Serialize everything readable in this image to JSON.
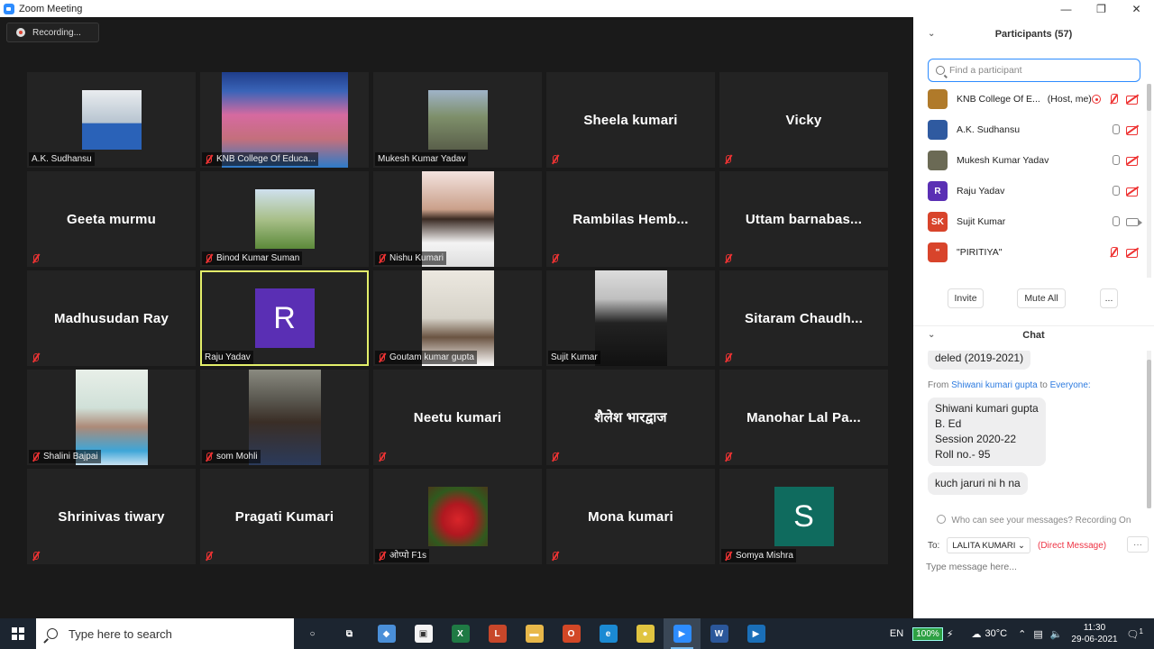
{
  "window": {
    "title": "Zoom Meeting",
    "controls": [
      "—",
      "❐",
      "✕"
    ]
  },
  "recording": {
    "label": "Recording..."
  },
  "tiles": [
    {
      "name": "A.K. Sudhansu",
      "type": "video",
      "muted": false
    },
    {
      "name": "KNB College Of Educa...",
      "type": "video",
      "muted": true
    },
    {
      "name": "Mukesh Kumar Yadav",
      "type": "video",
      "muted": false
    },
    {
      "name": "Sheela kumari",
      "type": "name",
      "muted": true
    },
    {
      "name": "Vicky",
      "type": "name",
      "muted": true
    },
    {
      "name": "Geeta murmu",
      "type": "name",
      "muted": true
    },
    {
      "name": "Binod Kumar Suman",
      "type": "video",
      "muted": true
    },
    {
      "name": "Nishu Kumari",
      "type": "video",
      "muted": true
    },
    {
      "name": "Rambilas  Hemb...",
      "type": "name",
      "muted": true
    },
    {
      "name": "Uttam  barnabas...",
      "type": "name",
      "muted": true
    },
    {
      "name": "Madhusudan Ray",
      "type": "name",
      "muted": true
    },
    {
      "name": "Raju Yadav",
      "type": "avatar",
      "letter": "R",
      "color": "#5a2fb4",
      "muted": false,
      "active": true
    },
    {
      "name": "Goutam kumar gupta",
      "type": "video",
      "muted": true
    },
    {
      "name": "Sujit Kumar",
      "type": "video",
      "muted": false
    },
    {
      "name": "Sitaram  Chaudh...",
      "type": "name",
      "muted": true
    },
    {
      "name": "Shalini Bajpai",
      "type": "video",
      "muted": true
    },
    {
      "name": "som Mohli",
      "type": "video",
      "muted": true
    },
    {
      "name": "Neetu kumari",
      "type": "name",
      "muted": true
    },
    {
      "name": "शैलेश भारद्वाज",
      "type": "name",
      "muted": true
    },
    {
      "name": "Manohar Lal Pa...",
      "type": "name",
      "muted": true
    },
    {
      "name": "Shrinivas tiwary",
      "type": "name",
      "muted": true
    },
    {
      "name": "Pragati Kumari",
      "type": "name",
      "muted": true
    },
    {
      "name": "ओप्पो F1s",
      "type": "video",
      "muted": true
    },
    {
      "name": "Mona kumari",
      "type": "name",
      "muted": true
    },
    {
      "name": "Somya Mishra",
      "type": "avatar",
      "letter": "S",
      "color": "#0f6b5e",
      "muted": true
    }
  ],
  "participants": {
    "header": "Participants (57)",
    "search_placeholder": "Find a participant",
    "list": [
      {
        "name": "KNB College Of E...",
        "suffix": "(Host, me)",
        "avatar": "",
        "color": "#b07a2a",
        "mic": "muted",
        "cam": "off",
        "rec": true
      },
      {
        "name": "A.K. Sudhansu",
        "suffix": "",
        "avatar": "",
        "color": "#2f5aa0",
        "mic": "on",
        "cam": "off",
        "rec": false
      },
      {
        "name": "Mukesh Kumar Yadav",
        "suffix": "",
        "avatar": "",
        "color": "#6b6a55",
        "mic": "on",
        "cam": "off",
        "rec": false
      },
      {
        "name": "Raju Yadav",
        "suffix": "",
        "avatar": "R",
        "color": "#5a2fb4",
        "mic": "on",
        "cam": "off",
        "rec": false
      },
      {
        "name": "Sujit Kumar",
        "suffix": "",
        "avatar": "SK",
        "color": "#d8442b",
        "mic": "on",
        "cam": "on",
        "rec": false
      },
      {
        "name": "\"PIRITIYA\"",
        "suffix": "",
        "avatar": "\"",
        "color": "#d8442b",
        "mic": "muted",
        "cam": "off",
        "rec": false
      }
    ],
    "buttons": {
      "invite": "Invite",
      "mute_all": "Mute All",
      "more": "..."
    }
  },
  "chat": {
    "header": "Chat",
    "messages": [
      {
        "kind": "bubble",
        "text": "deled (2019-2021)"
      },
      {
        "kind": "from",
        "prefix": "From",
        "sender": "Shiwani kumari gupta",
        "to": "to",
        "recipient": "Everyone:"
      },
      {
        "kind": "bubble",
        "lines": [
          "Shiwani kumari gupta",
          "B. Ed",
          "Session 2020-22",
          "Roll no.- 95"
        ]
      },
      {
        "kind": "bubble",
        "text": "kuch jaruri ni h na"
      }
    ],
    "who_can_see": "Who can see your messages? Recording On",
    "to_label": "To:",
    "recipient": "LALITA KUMARI",
    "direct": "(Direct Message)",
    "more": "···",
    "input_placeholder": "Type message here..."
  },
  "taskbar": {
    "search_placeholder": "Type here to search",
    "apps": [
      "cortana",
      "task-view",
      "photos",
      "store",
      "excel",
      "office-lens",
      "file-explorer",
      "office",
      "edge",
      "chrome",
      "zoom",
      "word",
      "media-player"
    ],
    "lang": "EN",
    "battery": "100%",
    "temp": "30°C",
    "time": "11:30",
    "date": "29-06-2021",
    "notifications": "1"
  }
}
